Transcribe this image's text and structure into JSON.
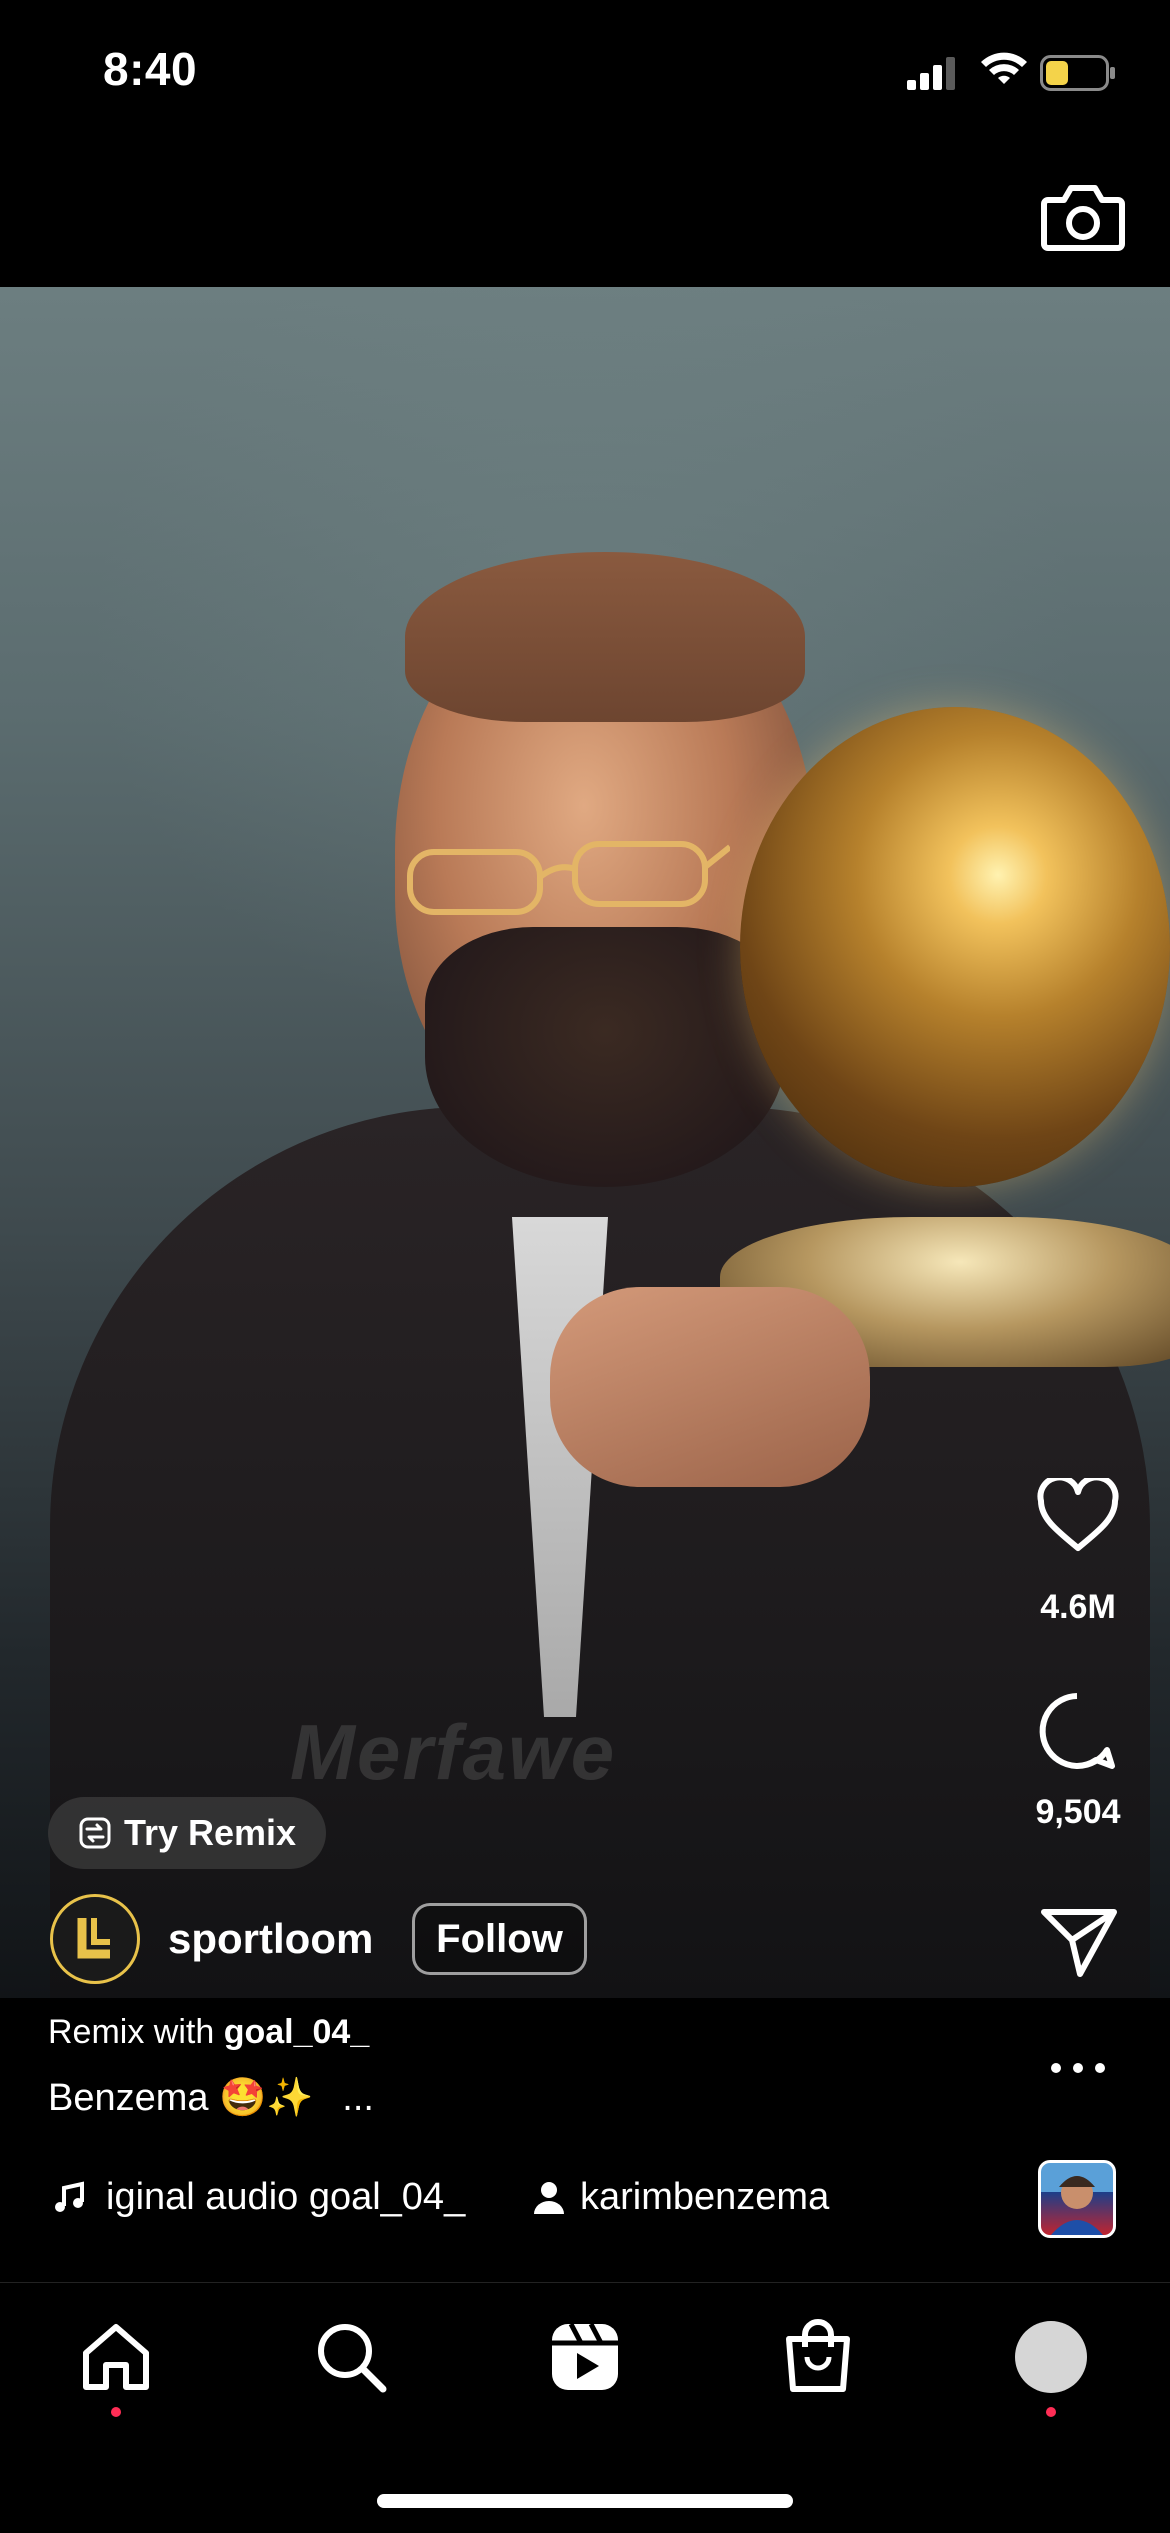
{
  "status_bar": {
    "time": "8:40"
  },
  "video": {
    "watermark": "Merfawe"
  },
  "remix_chip": {
    "label": "Try Remix"
  },
  "user": {
    "username": "sportloom",
    "follow_label": "Follow"
  },
  "remix_with": {
    "prefix": "Remix with",
    "account": "goal_04_"
  },
  "caption": {
    "text": "Benzema 🤩✨",
    "more": "..."
  },
  "audio": {
    "text": "iginal audio  goal_04_"
  },
  "tagged": {
    "account": "karimbenzema"
  },
  "actions": {
    "likes": "4.6M",
    "comments": "9,504"
  },
  "nav": {
    "items": [
      "home",
      "search",
      "reels",
      "shop",
      "profile"
    ]
  },
  "colors": {
    "notification_dot": "#ff2d55",
    "avatar_ring": "#e8c24a",
    "battery_fill": "#f4d34a"
  }
}
